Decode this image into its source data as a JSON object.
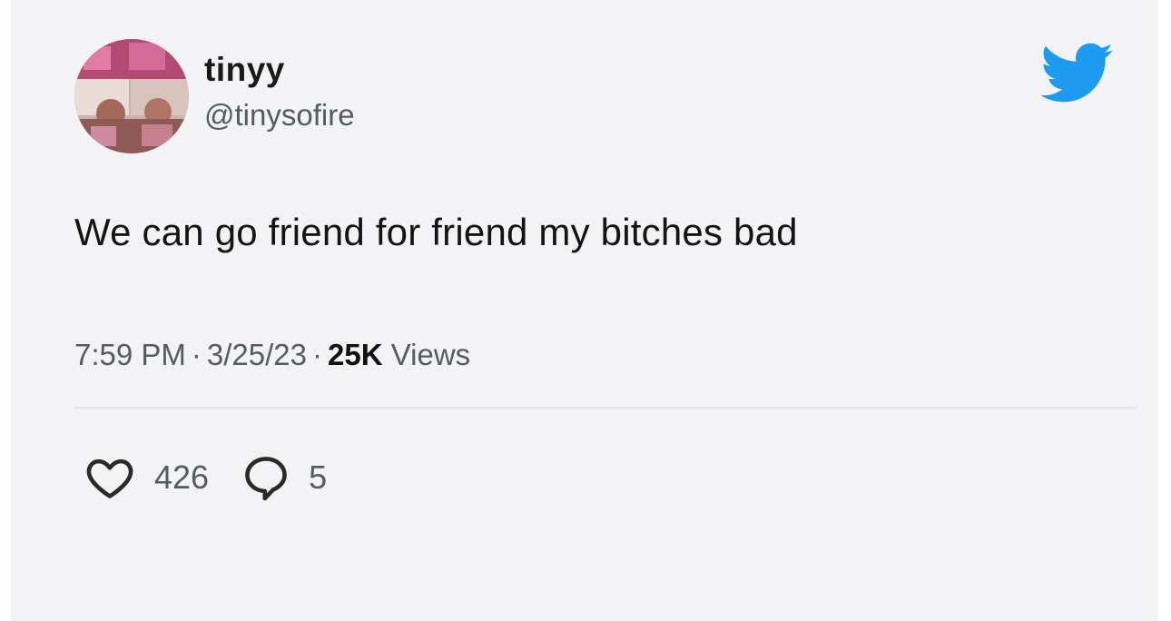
{
  "author": {
    "display_name": "tinyy",
    "handle": "@tinysofire"
  },
  "tweet": {
    "text": "We can go friend for friend my bitches bad",
    "time": "7:59 PM",
    "date": "3/25/23",
    "views_count": "25K",
    "views_label": "Views",
    "separator": "·"
  },
  "stats": {
    "likes": "426",
    "replies": "5"
  },
  "icons": {
    "brand": "twitter-bird-icon",
    "like": "heart-icon",
    "reply": "speech-bubble-icon"
  },
  "colors": {
    "brand": "#1d9bf0",
    "background": "#f3f3f5",
    "text_primary": "#141414",
    "text_secondary": "#545c63"
  }
}
